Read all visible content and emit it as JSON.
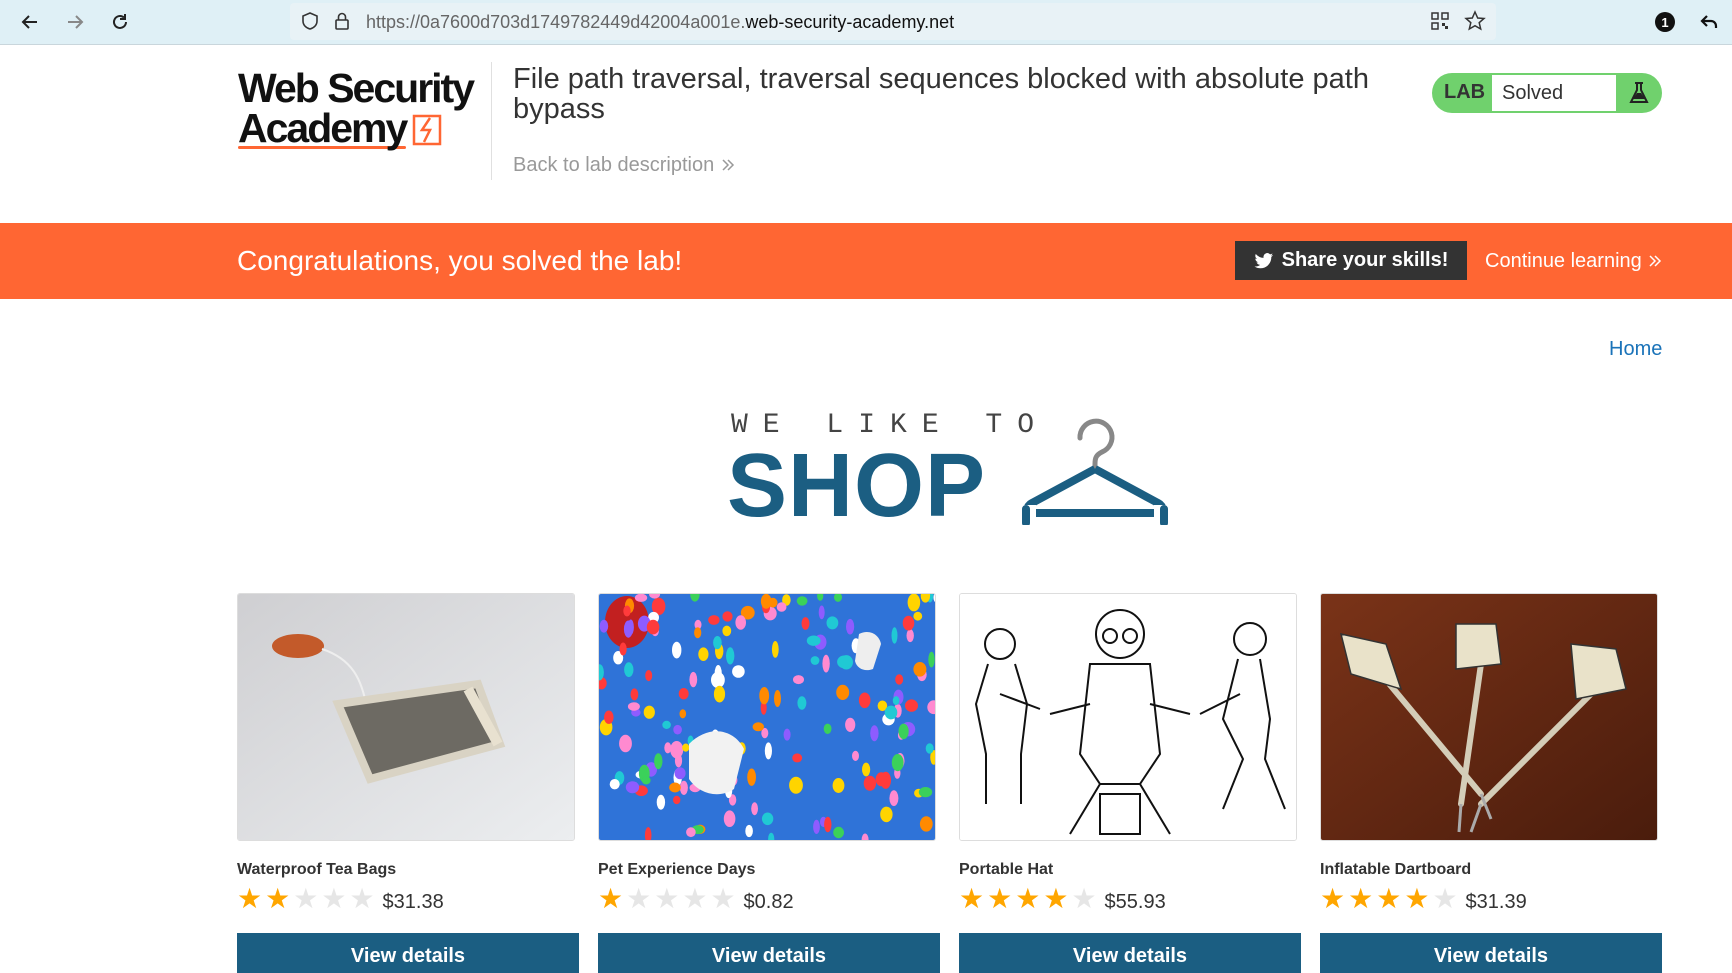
{
  "browser": {
    "url_prefix": "https://0a7600d703d1749782449d42004a001e.",
    "url_host": "web-security-academy.net",
    "badge_count": "1"
  },
  "header": {
    "logo_text_1": "Web Security",
    "logo_text_2": "Academy",
    "lab_title": "File path traversal, traversal sequences blocked with absolute path bypass",
    "back_link": "Back to lab description",
    "lab_tag": "LAB",
    "lab_status": "Solved"
  },
  "banner": {
    "message": "Congratulations, you solved the lab!",
    "share_label": "Share your skills!",
    "continue_label": "Continue learning"
  },
  "nav": {
    "home": "Home"
  },
  "hero": {
    "small": "WE LIKE TO",
    "big": "SHOP"
  },
  "colors": {
    "accent": "#ff6633",
    "primary": "#1b5e82",
    "lab_green": "#70d16d",
    "star": "#ffa600"
  },
  "products": [
    {
      "name": "Waterproof Tea Bags",
      "rating": 2,
      "price": "$31.38",
      "button": "View details"
    },
    {
      "name": "Pet Experience Days",
      "rating": 1,
      "price": "$0.82",
      "button": "View details"
    },
    {
      "name": "Portable Hat",
      "rating": 4,
      "price": "$55.93",
      "button": "View details"
    },
    {
      "name": "Inflatable Dartboard",
      "rating": 4,
      "price": "$31.39",
      "button": "View details"
    }
  ]
}
